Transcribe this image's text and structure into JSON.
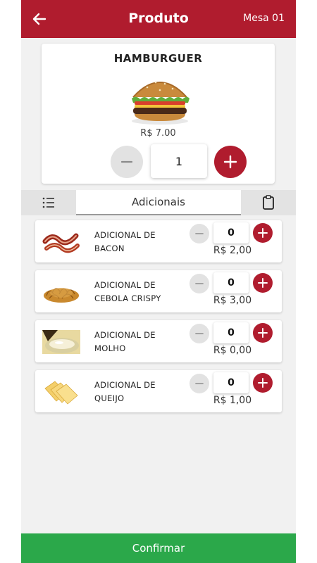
{
  "header": {
    "title": "Produto",
    "table": "Mesa 01",
    "back_icon": "arrow-left-icon"
  },
  "product": {
    "name": "HAMBURGUER",
    "price": "R$ 7.00",
    "quantity": "1"
  },
  "tabs": {
    "active_label": "Adicionais",
    "left_icon": "list-icon",
    "right_icon": "clipboard-icon"
  },
  "addons": [
    {
      "line1": "ADICIONAL DE",
      "line2": "BACON",
      "quantity": "0",
      "price": "R$ 2,00"
    },
    {
      "line1": "ADICIONAL DE",
      "line2": "CEBOLA CRISPY",
      "quantity": "0",
      "price": "R$ 3,00"
    },
    {
      "line1": "ADICIONAL DE",
      "line2": "MOLHO",
      "quantity": "0",
      "price": "R$ 0,00"
    },
    {
      "line1": "ADICIONAL DE",
      "line2": "QUEIJO",
      "quantity": "0",
      "price": "R$ 1,00"
    }
  ],
  "footer": {
    "confirm_label": "Confirmar"
  },
  "colors": {
    "primary": "#b01c2e",
    "confirm": "#2ba84a",
    "background": "#f1f1f1"
  }
}
